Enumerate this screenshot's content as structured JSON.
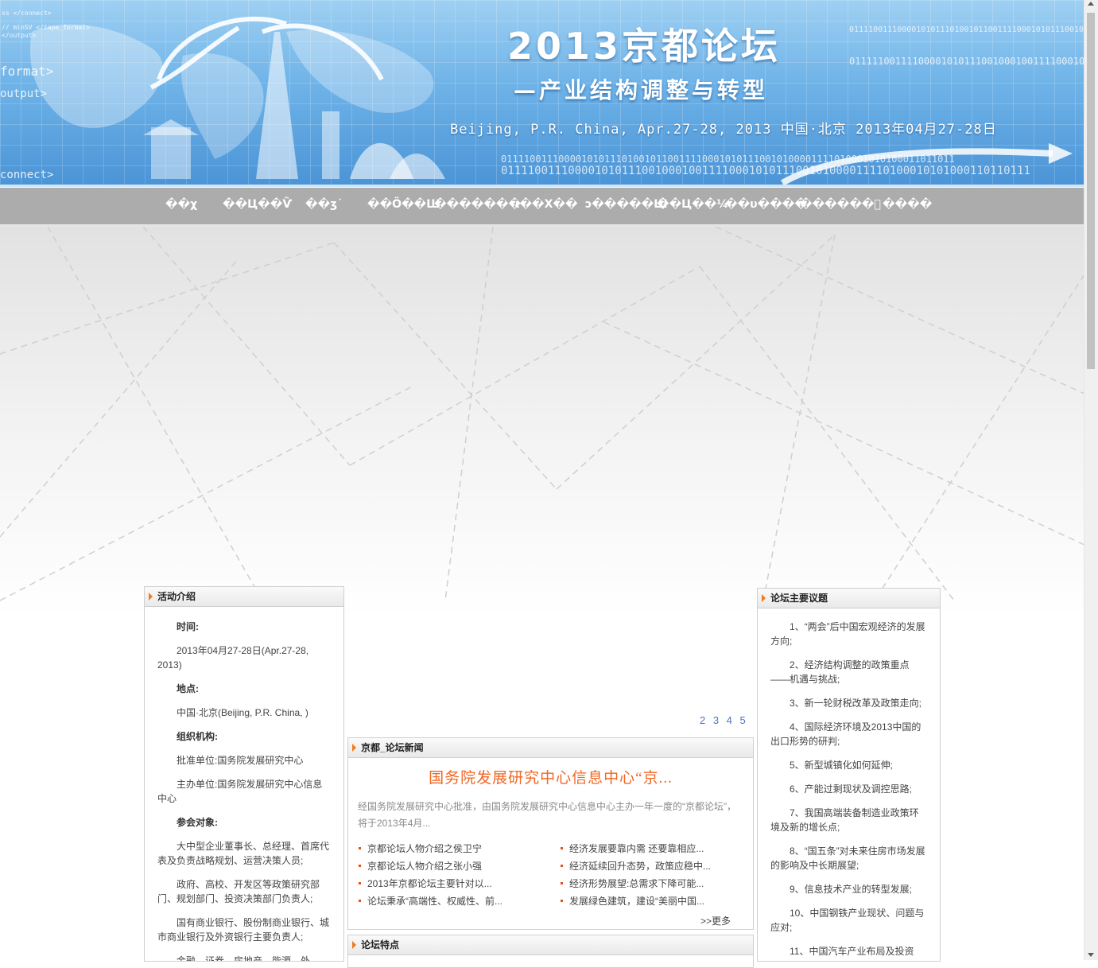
{
  "banner": {
    "title": "2013京都论坛",
    "subtitle": "—产业结构调整与转型",
    "date_line": "Beijing, P.R. China, Apr.27-28, 2013  中国·北京 2013年04月27-28日",
    "code_lines": [
      "ss </connect>",
      "// minSV </tape_format>",
      "</output>",
      "format>",
      "output>",
      "connect>"
    ],
    "bits_lines": [
      "0111100111000010101110100101100111100010101110010100001111010001010100011011011",
      "0111110011110000101011100100010011110001010111001000100111011110101000100001000",
      "0111100111000010101110100101100111100010101110010100001111010001010100011011011",
      "0111100111000010101110010001001111000101011100101000011110100010101000110110111"
    ]
  },
  "nav": {
    "items": [
      "��χ",
      "��Ц��Ѷ",
      "��ʒ˙",
      "��Ö��Ш",
      "�������·",
      "ι��Χ��",
      "ɔ�����Ш",
      "��Ц��¼",
      "��υ����",
      "������ฺ",
      "����"
    ]
  },
  "left_panel": {
    "title": "活动介绍",
    "time_label": "时间:",
    "time_value": "2013年04月27-28日(Apr.27-28, 2013)",
    "place_label": "地点:",
    "place_value": "中国·北京(Beijing, P.R. China, )",
    "org_label": "组织机构:",
    "org_approve": "批准单位:国务院发展研究中心",
    "org_host": "主办单位:国务院发展研究中心信息中心",
    "attendee_label": "参会对象:",
    "attendees": [
      "大中型企业董事长、总经理、首席代表及负责战略规划、运营决策人员;",
      "政府、高校、开发区等政策研究部门、规划部门、投资决策部门负责人;",
      "国有商业银行、股份制商业银行、城市商业银行及外资银行主要负责人;",
      "金融、证券、房地产、能源、外"
    ]
  },
  "pager": "2 3 4 5",
  "news_panel": {
    "title": "京都_论坛新闻",
    "headline": "国务院发展研究中心信息中心“京...",
    "summary": "经国务院发展研究中心批准，由国务院发展研究中心信息中心主办一年一度的“京都论坛”，将于2013年4月...",
    "left_items": [
      "京都论坛人物介绍之侯卫宁",
      "京都论坛人物介绍之张小强",
      "2013年京都论坛主要针对以...",
      "论坛秉承“高端性、权威性、前..."
    ],
    "right_items": [
      "经济发展要靠内需 还要靠相应...",
      "经济延续回升态势，政策应稳中...",
      "经济形势展望:总需求下降可能...",
      "发展绿色建筑，建设“美丽中国..."
    ],
    "more": ">>更多"
  },
  "feature_panel": {
    "title": "论坛特点"
  },
  "right_panel": {
    "title": "论坛主要议题",
    "topics": [
      "1、“两会”后中国宏观经济的发展方向;",
      "2、经济结构调整的政策重点——机遇与挑战;",
      "3、新一轮财税改革及政策走向;",
      "4、国际经济环境及2013中国的出口形势的研判;",
      "5、新型城镇化如何延伸;",
      "6、产能过剩现状及调控思路;",
      "7、我国高端装备制造业政策环境及新的增长点;",
      "8、“国五条”对未来住房市场发展的影响及中长期展望;",
      "9、信息技术产业的转型发展;",
      "10、中国钢铁产业现状、问题与应对;",
      "11、中国汽车产业布局及投资"
    ]
  },
  "colors": {
    "accent": "#f26622",
    "nav_bg": "#acacac",
    "link_blue": "#4a74b8"
  }
}
